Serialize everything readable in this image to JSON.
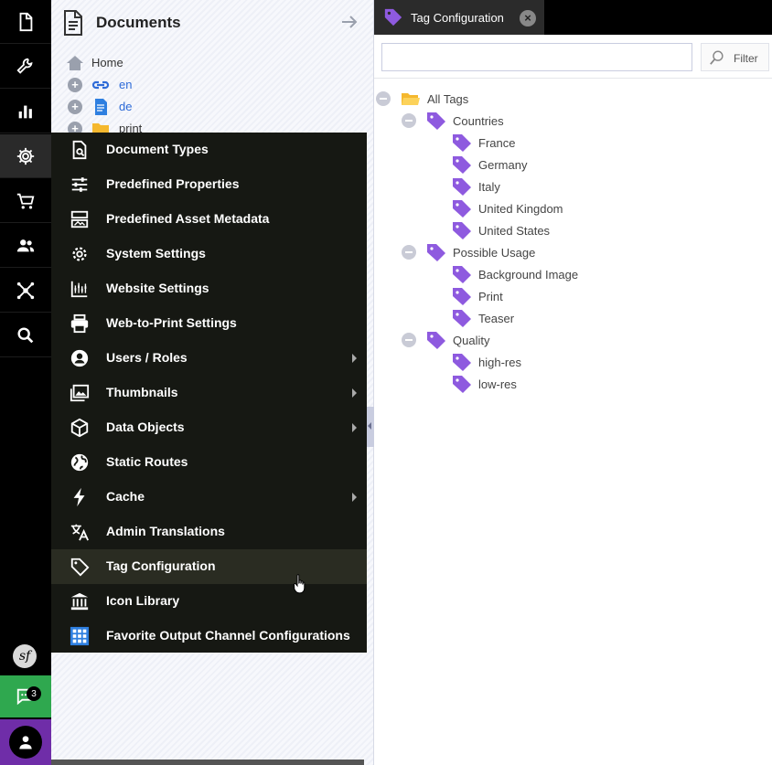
{
  "colors": {
    "rail_bg": "#000000",
    "chat_bg": "#2fa84f",
    "user_bg": "#6f2da8",
    "menu_bg": "#161813",
    "tag_purple": "#8e5adf",
    "link_blue": "#2e6bd8"
  },
  "rail": {
    "items": [
      {
        "icon": "document-icon"
      },
      {
        "icon": "wrench-icon"
      },
      {
        "icon": "bar-chart-icon"
      },
      {
        "icon": "gear-icon"
      },
      {
        "icon": "cart-icon"
      },
      {
        "icon": "users-icon"
      },
      {
        "icon": "network-icon"
      },
      {
        "icon": "search-icon"
      }
    ],
    "symfony_glyph": "sf",
    "chat_badge": "3"
  },
  "documents": {
    "title": "Documents",
    "tree": [
      {
        "label": "Home",
        "icon": "home-icon"
      },
      {
        "label": "en",
        "icon": "link-icon"
      },
      {
        "label": "de",
        "icon": "page-icon"
      },
      {
        "label": "print",
        "icon": "folder-icon"
      }
    ]
  },
  "settings_menu": {
    "items": [
      {
        "label": "Document Types",
        "icon": "document-types-icon",
        "submenu": false
      },
      {
        "label": "Predefined Properties",
        "icon": "sliders-icon",
        "submenu": false
      },
      {
        "label": "Predefined Asset Metadata",
        "icon": "metadata-icon",
        "submenu": false
      },
      {
        "label": "System Settings",
        "icon": "gear-icon",
        "submenu": false
      },
      {
        "label": "Website Settings",
        "icon": "website-settings-icon",
        "submenu": false
      },
      {
        "label": "Web-to-Print Settings",
        "icon": "printer-icon",
        "submenu": false
      },
      {
        "label": "Users / Roles",
        "icon": "user-circle-icon",
        "submenu": true
      },
      {
        "label": "Thumbnails",
        "icon": "images-icon",
        "submenu": true
      },
      {
        "label": "Data Objects",
        "icon": "cube-icon",
        "submenu": true
      },
      {
        "label": "Static Routes",
        "icon": "globe-icon",
        "submenu": false
      },
      {
        "label": "Cache",
        "icon": "lightning-icon",
        "submenu": true
      },
      {
        "label": "Admin Translations",
        "icon": "translate-icon",
        "submenu": false
      },
      {
        "label": "Tag Configuration",
        "icon": "tag-icon",
        "submenu": false
      },
      {
        "label": "Icon Library",
        "icon": "library-icon",
        "submenu": false
      },
      {
        "label": "Favorite Output Channel Configurations",
        "icon": "grid-icon",
        "submenu": false
      }
    ],
    "hovered": "Tag Configuration"
  },
  "tab": {
    "label": "Tag Configuration",
    "close": "×"
  },
  "filter": {
    "placeholder": "",
    "button_label": "Filter"
  },
  "tag_tree": {
    "root": "All Tags",
    "groups": [
      {
        "label": "Countries",
        "children": [
          "France",
          "Germany",
          "Italy",
          "United Kingdom",
          "United States"
        ]
      },
      {
        "label": "Possible Usage",
        "children": [
          "Background Image",
          "Print",
          "Teaser"
        ]
      },
      {
        "label": "Quality",
        "children": [
          "high-res",
          "low-res"
        ]
      }
    ]
  }
}
